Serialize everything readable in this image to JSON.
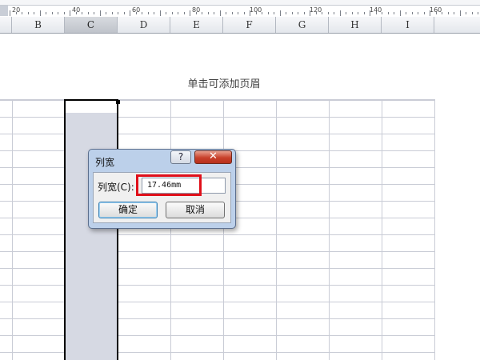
{
  "ruler": {
    "labels": [
      "20",
      "40",
      "60",
      "80",
      "100",
      "120",
      "140",
      "160"
    ]
  },
  "columns": [
    "B",
    "C",
    "D",
    "E",
    "F",
    "G",
    "H",
    "I"
  ],
  "selected_column": "C",
  "page": {
    "header_hint": "单击可添加页眉"
  },
  "dialog": {
    "title": "列宽",
    "help_label": "?",
    "close_label": "✕",
    "field_label": "列宽(C):",
    "field_value": "17.46mm",
    "ok_label": "确定",
    "cancel_label": "取消"
  },
  "colors": {
    "highlight": "#e0101a",
    "selected_column_fill": "#d6d9e3"
  }
}
